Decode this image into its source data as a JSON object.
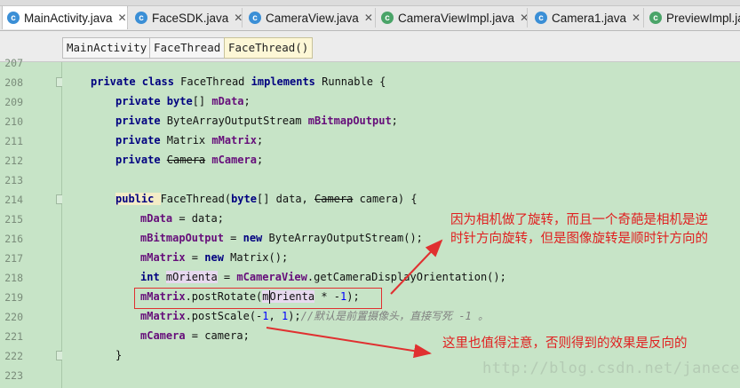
{
  "tabs": [
    {
      "label": "MainActivity.java",
      "active": true,
      "icon": "c-class-icon",
      "closable": true
    },
    {
      "label": "FaceSDK.java",
      "active": false,
      "icon": "c-class-icon",
      "closable": true
    },
    {
      "label": "CameraView.java",
      "active": false,
      "icon": "c-class-icon",
      "closable": true
    },
    {
      "label": "CameraViewImpl.java",
      "active": false,
      "icon": "c-abstract-icon",
      "closable": true
    },
    {
      "label": "Camera1.java",
      "active": false,
      "icon": "c-class-icon",
      "closable": true
    },
    {
      "label": "PreviewImpl.java",
      "active": false,
      "icon": "c-abstract-icon",
      "closable": false
    }
  ],
  "breadcrumb": [
    "MainActivity",
    "FaceThread",
    "FaceThread()"
  ],
  "line_numbers": [
    "207",
    "208",
    "209",
    "210",
    "211",
    "212",
    "213",
    "214",
    "215",
    "216",
    "217",
    "218",
    "219",
    "220",
    "221",
    "222",
    "223"
  ],
  "code": {
    "l208": {
      "k1": "private class ",
      "t": "FaceThread ",
      "k2": "implements ",
      "t2": "Runnable {"
    },
    "l209": {
      "k": "private byte",
      "t": "[] ",
      "f": "mData",
      "t2": ";"
    },
    "l210": {
      "k": "private ",
      "t": "ByteArrayOutputStream ",
      "f": "mBitmapOutput",
      "t2": ";"
    },
    "l211": {
      "k": "private ",
      "t": "Matrix ",
      "f": "mMatrix",
      "t2": ";"
    },
    "l212": {
      "k": "private ",
      "s": "Camera",
      "t": " ",
      "f": "mCamera",
      "t2": ";"
    },
    "l214": {
      "k": "public ",
      "t": "FaceThread(",
      "k2": "byte",
      "t2": "[] data, ",
      "s": "Camera",
      "t3": " camera) {"
    },
    "l215": {
      "f": "mData",
      "t": " = data;"
    },
    "l216": {
      "f": "mBitmapOutput",
      "t": " = ",
      "k": "new ",
      "t2": "ByteArrayOutputStream();"
    },
    "l217": {
      "f": "mMatrix",
      "t": " = ",
      "k": "new ",
      "t2": "Matrix();"
    },
    "l218": {
      "k": "int ",
      "v": "mOrienta",
      "t": " = ",
      "f": "mCameraView",
      "t2": ".getCameraDisplayOrientation();"
    },
    "l219": {
      "f": "mMatrix",
      "t": ".postRotate(",
      "v1": "m",
      "v2": "Orienta",
      "t2": " * -",
      "n": "1",
      "t3": ");"
    },
    "l220": {
      "f": "mMatrix",
      "t": ".postScale(-",
      "n1": "1",
      "t2": ", ",
      "n2": "1",
      "t3": ");",
      "c": "//默认是前置摄像头，直接写死 -1 。"
    },
    "l221": {
      "f": "mCamera",
      "t": " = camera;"
    },
    "l222": {
      "t": "}"
    }
  },
  "annotations": {
    "note1_line1": "因为相机做了旋转，而且一个奇葩是相机是逆",
    "note1_line2": "时针方向旋转，但是图像旋转是顺时针方向的",
    "note2": "这里也值得注意，否则得到的效果是反向的"
  },
  "watermark": "http://blog.csdn.net/janecer",
  "colors": {
    "editor_bg": "#c7e4c7",
    "keyword": "#000080",
    "field": "#660e7a",
    "annotation": "#e02020"
  }
}
